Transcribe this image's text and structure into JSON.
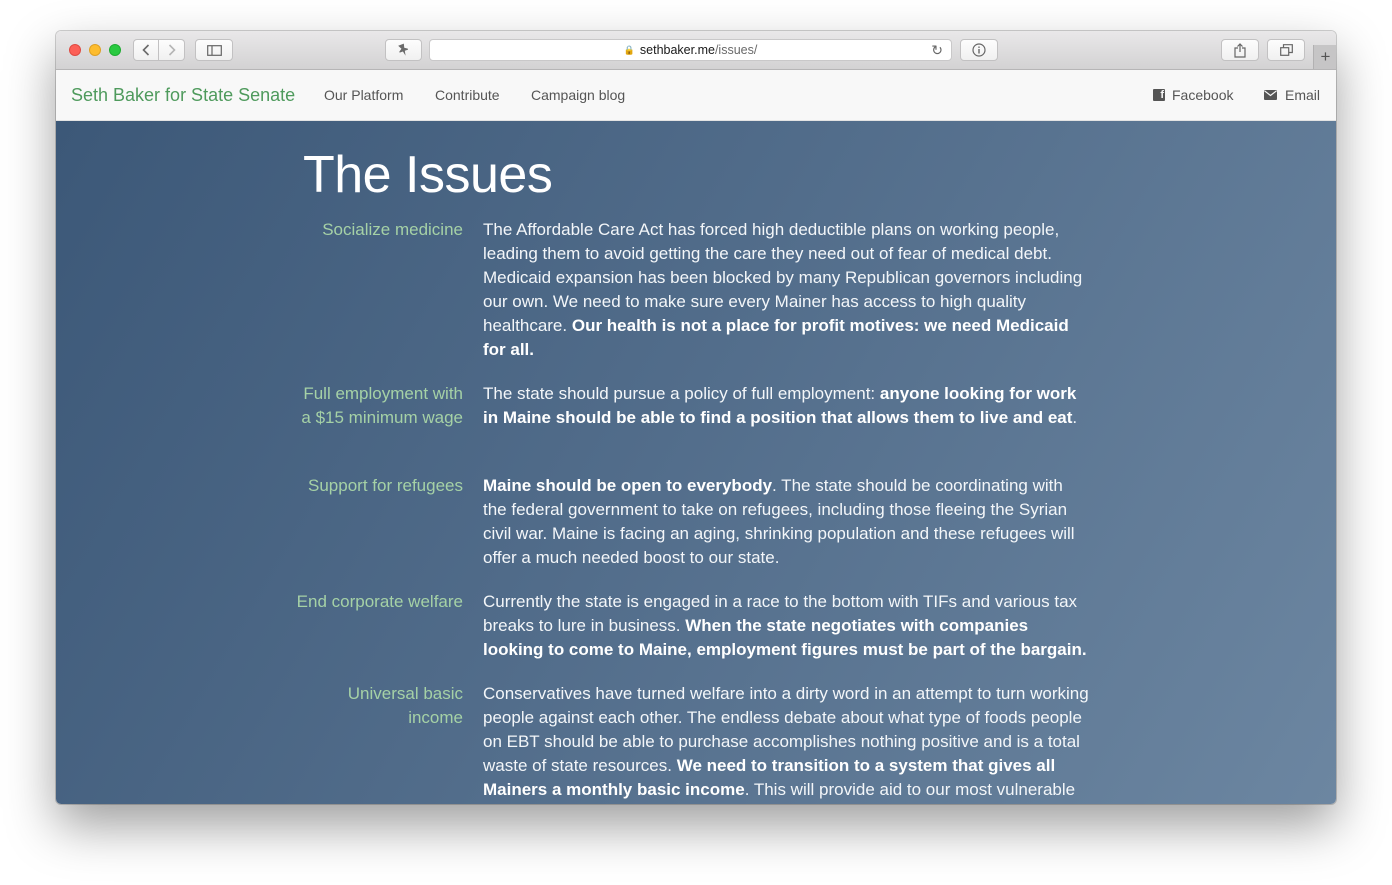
{
  "browser": {
    "url_host": "sethbaker.me",
    "url_path": "/issues/",
    "icons": {
      "back": "chevron-left-icon",
      "forward": "chevron-right-icon",
      "sidebar": "sidebar-icon",
      "pin": "pin-icon",
      "lock": "lock-icon",
      "reload": "reload-icon",
      "info": "info-icon",
      "share": "share-icon",
      "tabs": "tabs-icon",
      "new_tab": "plus-icon"
    }
  },
  "navbar": {
    "brand": "Seth Baker for State Senate",
    "links": [
      "Our Platform",
      "Contribute",
      "Campaign blog"
    ],
    "right_links": [
      {
        "label": "Facebook",
        "icon": "facebook-icon"
      },
      {
        "label": "Email",
        "icon": "envelope-icon"
      }
    ]
  },
  "page": {
    "title": "The Issues",
    "issues": [
      {
        "label": "Socialize medicine",
        "segments": [
          {
            "text": "The Affordable Care Act has forced high deductible plans on working people, leading them to avoid getting the care they need out of fear of medical debt. Medicaid expansion has been blocked by many Republican governors including our own. We need to make sure every Mainer has access to high quality healthcare. ",
            "bold": false
          },
          {
            "text": "Our health is not a place for profit motives: we need Medicaid for all.",
            "bold": true
          }
        ]
      },
      {
        "label": "Full employment with a $15 minimum wage",
        "segments": [
          {
            "text": "The state should pursue a policy of full employment: ",
            "bold": false
          },
          {
            "text": "anyone looking for work in Maine should be able to find a position that allows them to live and eat",
            "bold": true
          },
          {
            "text": ".",
            "bold": false
          }
        ]
      },
      {
        "label": "Support for refugees",
        "segments": [
          {
            "text": "Maine should be open to everybody",
            "bold": true
          },
          {
            "text": ". The state should be coordinating with the federal government to take on refugees, including those fleeing the Syrian civil war. Maine is facing an aging, shrinking population and these refugees will offer a much needed boost to our state.",
            "bold": false
          }
        ]
      },
      {
        "label": "End corporate welfare",
        "segments": [
          {
            "text": "Currently the state is engaged in a race to the bottom with TIFs and various tax breaks to lure in business. ",
            "bold": false
          },
          {
            "text": "When the state negotiates with companies looking to come to Maine, employment figures must be part of the bargain.",
            "bold": true
          }
        ]
      },
      {
        "label": "Universal basic income",
        "segments": [
          {
            "text": "Conservatives have turned welfare into a dirty word in an attempt to turn working people against each other. The endless debate about what type of foods people on EBT should be able to purchase accomplishes nothing positive and is a total waste of state resources. ",
            "bold": false
          },
          {
            "text": "We need to transition to a system that gives all Mainers a monthly basic income",
            "bold": true
          },
          {
            "text": ". This will provide aid to our most vulnerable as",
            "bold": false
          }
        ]
      }
    ]
  },
  "colors": {
    "brand": "#4e9a5c",
    "issue_label": "#a5d1a6",
    "content_bg_start": "#3c5878",
    "content_bg_end": "#6c86a1"
  }
}
